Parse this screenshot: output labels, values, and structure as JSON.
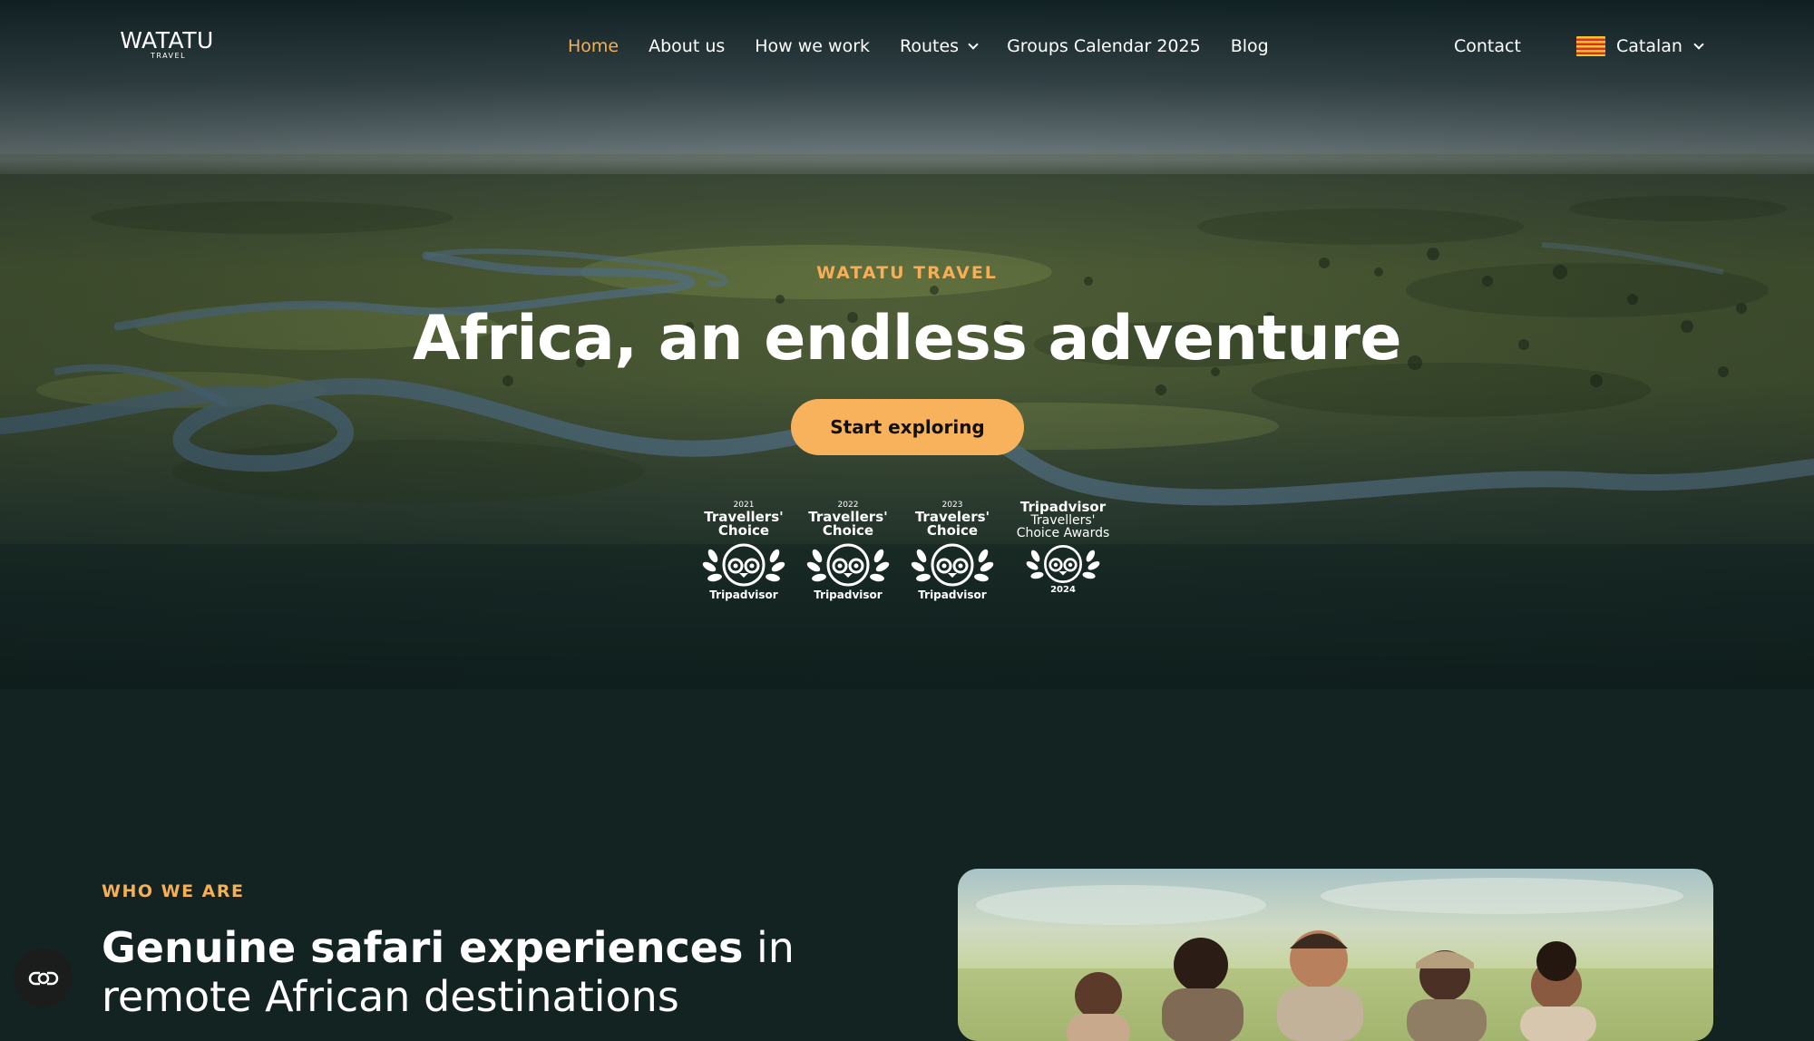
{
  "brand": {
    "logo_main": "WATATU",
    "logo_sub": "TRAVEL"
  },
  "nav": {
    "items": [
      {
        "label": "Home",
        "active": true
      },
      {
        "label": "About us"
      },
      {
        "label": "How we work"
      },
      {
        "label": "Routes",
        "has_dropdown": true
      },
      {
        "label": "Groups Calendar 2025"
      },
      {
        "label": "Blog"
      }
    ],
    "contact": "Contact",
    "language": {
      "label": "Catalan",
      "flag_icon": "catalan-flag-icon"
    }
  },
  "hero": {
    "eyebrow": "WATATU TRAVEL",
    "title": "Africa, an endless adventure",
    "cta": "Start exploring",
    "awards": [
      {
        "year": "2021",
        "line1": "Travellers'",
        "line2": "Choice",
        "brand": "Tripadvisor"
      },
      {
        "year": "2022",
        "line1": "Travellers'",
        "line2": "Choice",
        "brand": "Tripadvisor"
      },
      {
        "year": "2023",
        "line1": "Travelers'",
        "line2": "Choice",
        "brand": "Tripadvisor"
      },
      {
        "line1": "Tripadvisor",
        "line2": "Travellers'",
        "line3": "Choice Awards",
        "year": "2024"
      }
    ]
  },
  "who": {
    "eyebrow": "WHO WE ARE",
    "title_bold": "Genuine safari experiences",
    "title_rest": " in remote African destinations"
  },
  "colors": {
    "accent": "#f6ae57",
    "cta_bg": "#f9b25c",
    "page_bg": "#122321"
  }
}
